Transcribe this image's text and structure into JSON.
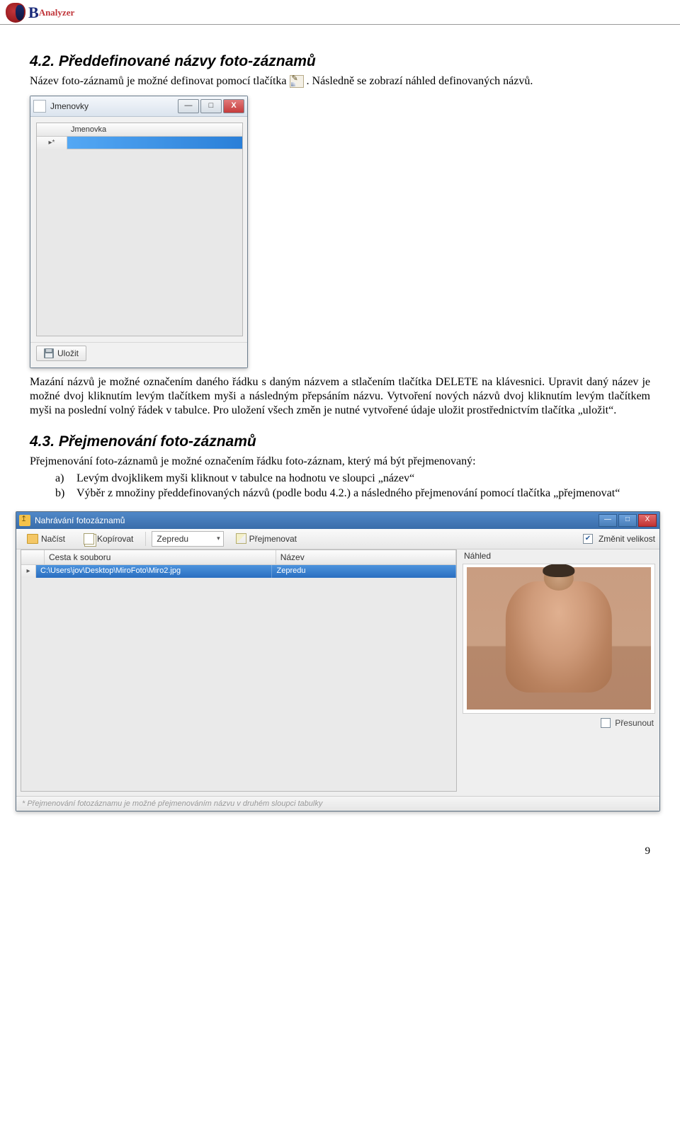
{
  "header": {
    "logo_b": "B",
    "logo_rest": "Analyzer"
  },
  "sec42": {
    "heading": "4.2. Předdefinované názvy foto-záznamů",
    "p1a": "Název foto-záznamů je možné definovat pomocí tlačítka ",
    "p1b": ". Následně se zobrazí náhled definovaných názvů.",
    "p2": "Mazání názvů je možné označením daného řádku s daným názvem a stlačením tlačítka DELETE na klávesnici. Upravit daný název je možné dvoj kliknutím levým tlačítkem myši a následným přepsáním názvu. Vytvoření nových názvů dvoj kliknutím levým tlačítkem myši na poslední volný řádek v tabulce. Pro uložení všech změn je nutné vytvořené údaje uložit prostřednictvím tlačítka „uložit“."
  },
  "jmenovky": {
    "title": "Jmenovky",
    "column": "Jmenovka",
    "row_indicator": "▸*",
    "save": "Uložit",
    "min": "—",
    "max": "□",
    "close": "X"
  },
  "sec43": {
    "heading": "4.3. Přejmenování foto-záznamů",
    "p_intro": "Přejmenování foto-záznamů je možné označením řádku foto-záznam, který má být přejmenovaný:",
    "a": "Levým dvojklikem myši kliknout v tabulce na hodnotu ve sloupci „název“",
    "b": "Výběr z množiny předdefinovaných názvů (podle bodu 4.2.) a následného přejmenování pomocí tlačítka „přejmenovat“"
  },
  "appwin": {
    "title": "Nahrávání fotozáznamů",
    "tb_load": "Načíst",
    "tb_copy": "Kopírovat",
    "tb_combo_value": "Zepredu",
    "tb_rename": "Přejmenovat",
    "tb_resize": "Změnit velikost",
    "col_path": "Cesta k souboru",
    "col_name": "Název",
    "row_indicator": "▸",
    "row_path": "C:\\Users\\jov\\Desktop\\MiroFoto\\Miro2.jpg",
    "row_name": "Zepredu",
    "preview_label": "Náhled",
    "move": "Přesunout",
    "status": "* Přejmenování fotozáznamu je možné přejmenováním názvu v druhém sloupci tabulky",
    "min": "—",
    "max": "□",
    "close": "X"
  },
  "page_number": "9"
}
